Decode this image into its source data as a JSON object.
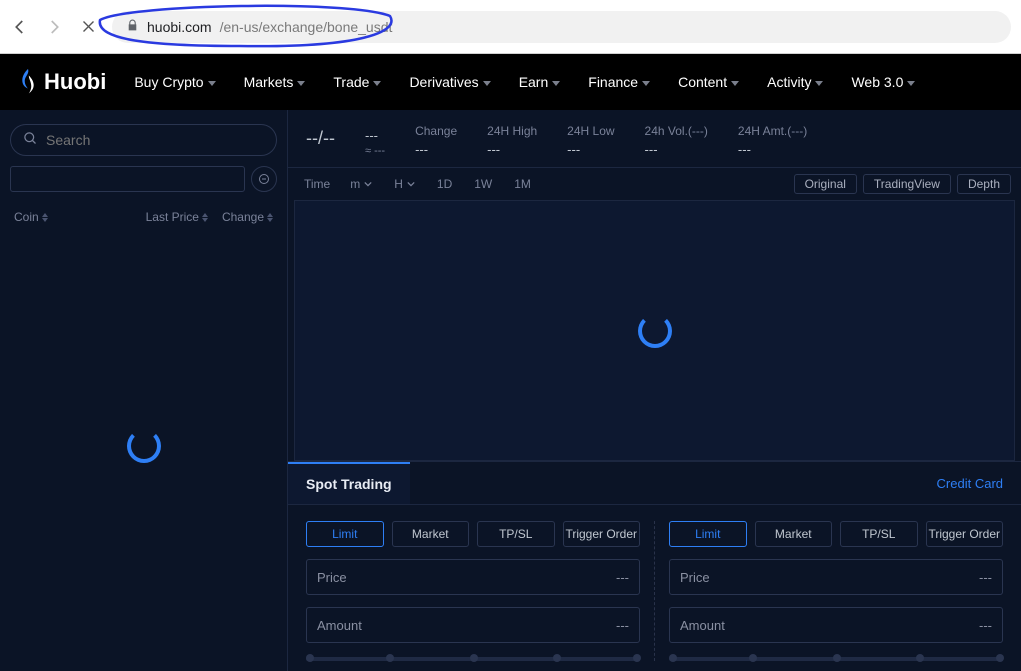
{
  "browser": {
    "url_host": "huobi.com",
    "url_path": "/en-us/exchange/bone_usdt"
  },
  "brand": "Huobi",
  "nav": {
    "items": [
      "Buy Crypto",
      "Markets",
      "Trade",
      "Derivatives",
      "Earn",
      "Finance",
      "Content",
      "Activity",
      "Web 3.0"
    ]
  },
  "sidebar": {
    "search_placeholder": "Search",
    "headers": {
      "coin": "Coin",
      "last_price": "Last Price",
      "change": "Change"
    }
  },
  "stats": {
    "pair": "--/--",
    "approx_prefix": "≈",
    "approx_value": "---",
    "price_value": "---",
    "change_label": "Change",
    "change_value": "---",
    "high_label": "24H High",
    "high_value": "---",
    "low_label": "24H Low",
    "low_value": "---",
    "vol_label": "24h Vol.(---)",
    "vol_value": "---",
    "amt_label": "24H Amt.(---)",
    "amt_value": "---"
  },
  "chart_toolbar": {
    "time_label": "Time",
    "m": "m",
    "h": "H",
    "tf_1d": "1D",
    "tf_1w": "1W",
    "tf_1m": "1M",
    "original": "Original",
    "tradingview": "TradingView",
    "depth": "Depth"
  },
  "trade": {
    "tab_spot": "Spot Trading",
    "credit_card": "Credit Card",
    "order_types": {
      "limit": "Limit",
      "market": "Market",
      "tpsl": "TP/SL",
      "trigger": "Trigger Order"
    },
    "fields": {
      "price": "Price",
      "amount": "Amount",
      "placeholder": "---"
    }
  }
}
